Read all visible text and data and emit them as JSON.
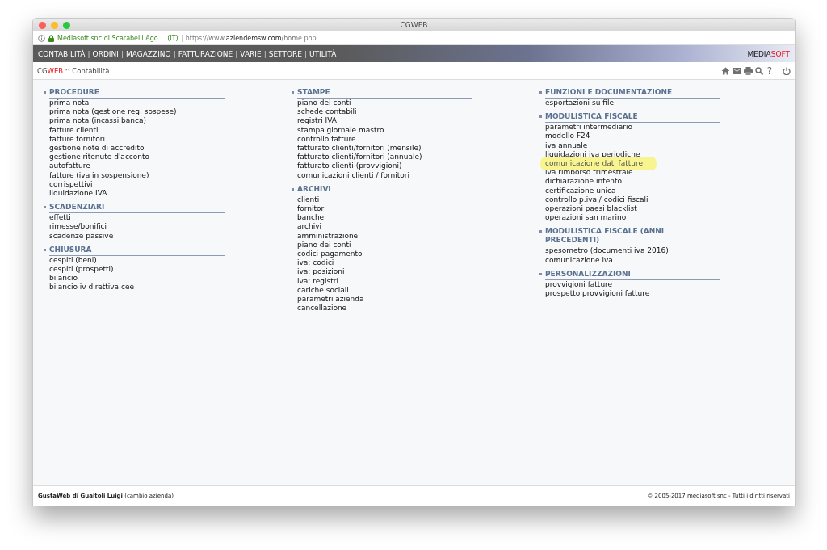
{
  "window": {
    "title": "CGWEB"
  },
  "address_bar": {
    "site_identity": "Mediasoft snc di Scarabelli Ago...",
    "country": "(IT)",
    "url": "https://www.**aziendemsw.com**/home.php"
  },
  "menu": [
    {
      "kind": "link",
      "label": "CONTABILITÀ"
    },
    {
      "kind": "separator",
      "label": "|"
    },
    {
      "kind": "link",
      "label": "ORDINI"
    },
    {
      "kind": "separator",
      "label": "|"
    },
    {
      "kind": "link",
      "label": "MAGAZZINO"
    },
    {
      "kind": "separator",
      "label": "|"
    },
    {
      "kind": "link",
      "label": "FATTURAZIONE"
    },
    {
      "kind": "separator",
      "label": "|"
    },
    {
      "kind": "link",
      "label": "VARIE"
    },
    {
      "kind": "separator",
      "label": "|"
    },
    {
      "kind": "link",
      "label": "SETTORE"
    },
    {
      "kind": "separator",
      "label": "|"
    },
    {
      "kind": "link",
      "label": "UTILITÀ"
    }
  ],
  "brand": {
    "part_1": "MEDIA",
    "part_2": "SOFT"
  },
  "breadcrumb": {
    "app_part_1": "CG",
    "app_part_2": "WEB",
    "path": ":: Contabilità"
  },
  "toolbar": {
    "help_glyph": "?"
  },
  "columns": [
    [
      {
        "title": "PROCEDURE",
        "items": [
          {
            "label": "prima nota",
            "highlighted": false
          },
          {
            "label": "prima nota (gestione reg. sospese)",
            "highlighted": false
          },
          {
            "label": "prima nota (incassi banca)",
            "highlighted": false
          },
          {
            "label": "fatture clienti",
            "highlighted": false
          },
          {
            "label": "fatture fornitori",
            "highlighted": false
          },
          {
            "label": "gestione note di accredito",
            "highlighted": false
          },
          {
            "label": "gestione ritenute d'acconto",
            "highlighted": false
          },
          {
            "label": "autofatture",
            "highlighted": false
          },
          {
            "label": "fatture (iva in sospensione)",
            "highlighted": false
          },
          {
            "label": "corrispettivi",
            "highlighted": false
          },
          {
            "label": "liquidazione IVA",
            "highlighted": false
          }
        ]
      },
      {
        "title": "SCADENZIARI",
        "items": [
          {
            "label": "effetti",
            "highlighted": false
          },
          {
            "label": "rimesse/bonifici",
            "highlighted": false
          },
          {
            "label": "scadenze passive",
            "highlighted": false
          }
        ]
      },
      {
        "title": "CHIUSURA",
        "items": [
          {
            "label": "cespiti (beni)",
            "highlighted": false
          },
          {
            "label": "cespiti (prospetti)",
            "highlighted": false
          },
          {
            "label": "bilancio",
            "highlighted": false
          },
          {
            "label": "bilancio iv direttiva cee",
            "highlighted": false
          }
        ]
      }
    ],
    [
      {
        "title": "STAMPE",
        "items": [
          {
            "label": "piano dei conti",
            "highlighted": false
          },
          {
            "label": "schede contabili",
            "highlighted": false
          },
          {
            "label": "registri IVA",
            "highlighted": false
          },
          {
            "label": "stampa giornale mastro",
            "highlighted": false
          },
          {
            "label": "controllo fatture",
            "highlighted": false
          },
          {
            "label": "fatturato clienti/fornitori (mensile)",
            "highlighted": false
          },
          {
            "label": "fatturato clienti/fornitori (annuale)",
            "highlighted": false
          },
          {
            "label": "fatturato clienti (provvigioni)",
            "highlighted": false
          },
          {
            "label": "comunicazioni clienti / fornitori",
            "highlighted": false
          }
        ]
      },
      {
        "title": "ARCHIVI",
        "items": [
          {
            "label": "clienti",
            "highlighted": false
          },
          {
            "label": "fornitori",
            "highlighted": false
          },
          {
            "label": "banche",
            "highlighted": false
          },
          {
            "label": "archivi",
            "highlighted": false
          },
          {
            "label": "amministrazione",
            "highlighted": false
          },
          {
            "label": "piano dei conti",
            "highlighted": false
          },
          {
            "label": "codici pagamento",
            "highlighted": false
          },
          {
            "label": "iva: codici",
            "highlighted": false
          },
          {
            "label": "iva: posizioni",
            "highlighted": false
          },
          {
            "label": "iva: registri",
            "highlighted": false
          },
          {
            "label": "cariche sociali",
            "highlighted": false
          },
          {
            "label": "parametri azienda",
            "highlighted": false
          },
          {
            "label": "cancellazione",
            "highlighted": false
          }
        ]
      }
    ],
    [
      {
        "title": "FUNZIONI E DOCUMENTAZIONE",
        "items": [
          {
            "label": "esportazioni su file",
            "highlighted": false
          }
        ]
      },
      {
        "title": "MODULISTICA FISCALE",
        "items": [
          {
            "label": "parametri intermediario",
            "highlighted": false
          },
          {
            "label": "modello F24",
            "highlighted": false
          },
          {
            "label": "iva annuale",
            "highlighted": false
          },
          {
            "label": "liquidazioni iva periodiche",
            "highlighted": false
          },
          {
            "label": "comunicazione dati fatture",
            "highlighted": true
          },
          {
            "label": "iva rimborso trimestrale",
            "highlighted": false
          },
          {
            "label": "dichiarazione intento",
            "highlighted": false
          },
          {
            "label": "certificazione unica",
            "highlighted": false
          },
          {
            "label": "controllo p.iva / codici fiscali",
            "highlighted": false
          },
          {
            "label": "operazioni paesi blacklist",
            "highlighted": false
          },
          {
            "label": "operazioni san marino",
            "highlighted": false
          }
        ]
      },
      {
        "title": "MODULISTICA FISCALE (ANNI PRECEDENTI)",
        "items": [
          {
            "label": "spesometro (documenti iva 2016)",
            "highlighted": false
          },
          {
            "label": "comunicazione iva",
            "highlighted": false
          }
        ]
      },
      {
        "title": "PERSONALIZZAZIONI",
        "items": [
          {
            "label": "provvigioni fatture",
            "highlighted": false
          },
          {
            "label": "prospetto provvigioni fatture",
            "highlighted": false
          }
        ]
      }
    ]
  ],
  "footer": {
    "company": "**GustaWeb di Guaitoli Luigi** (cambio azienda)",
    "copyright": "© 2005-2017 mediasoft snc - Tutti i diritti riservati"
  }
}
